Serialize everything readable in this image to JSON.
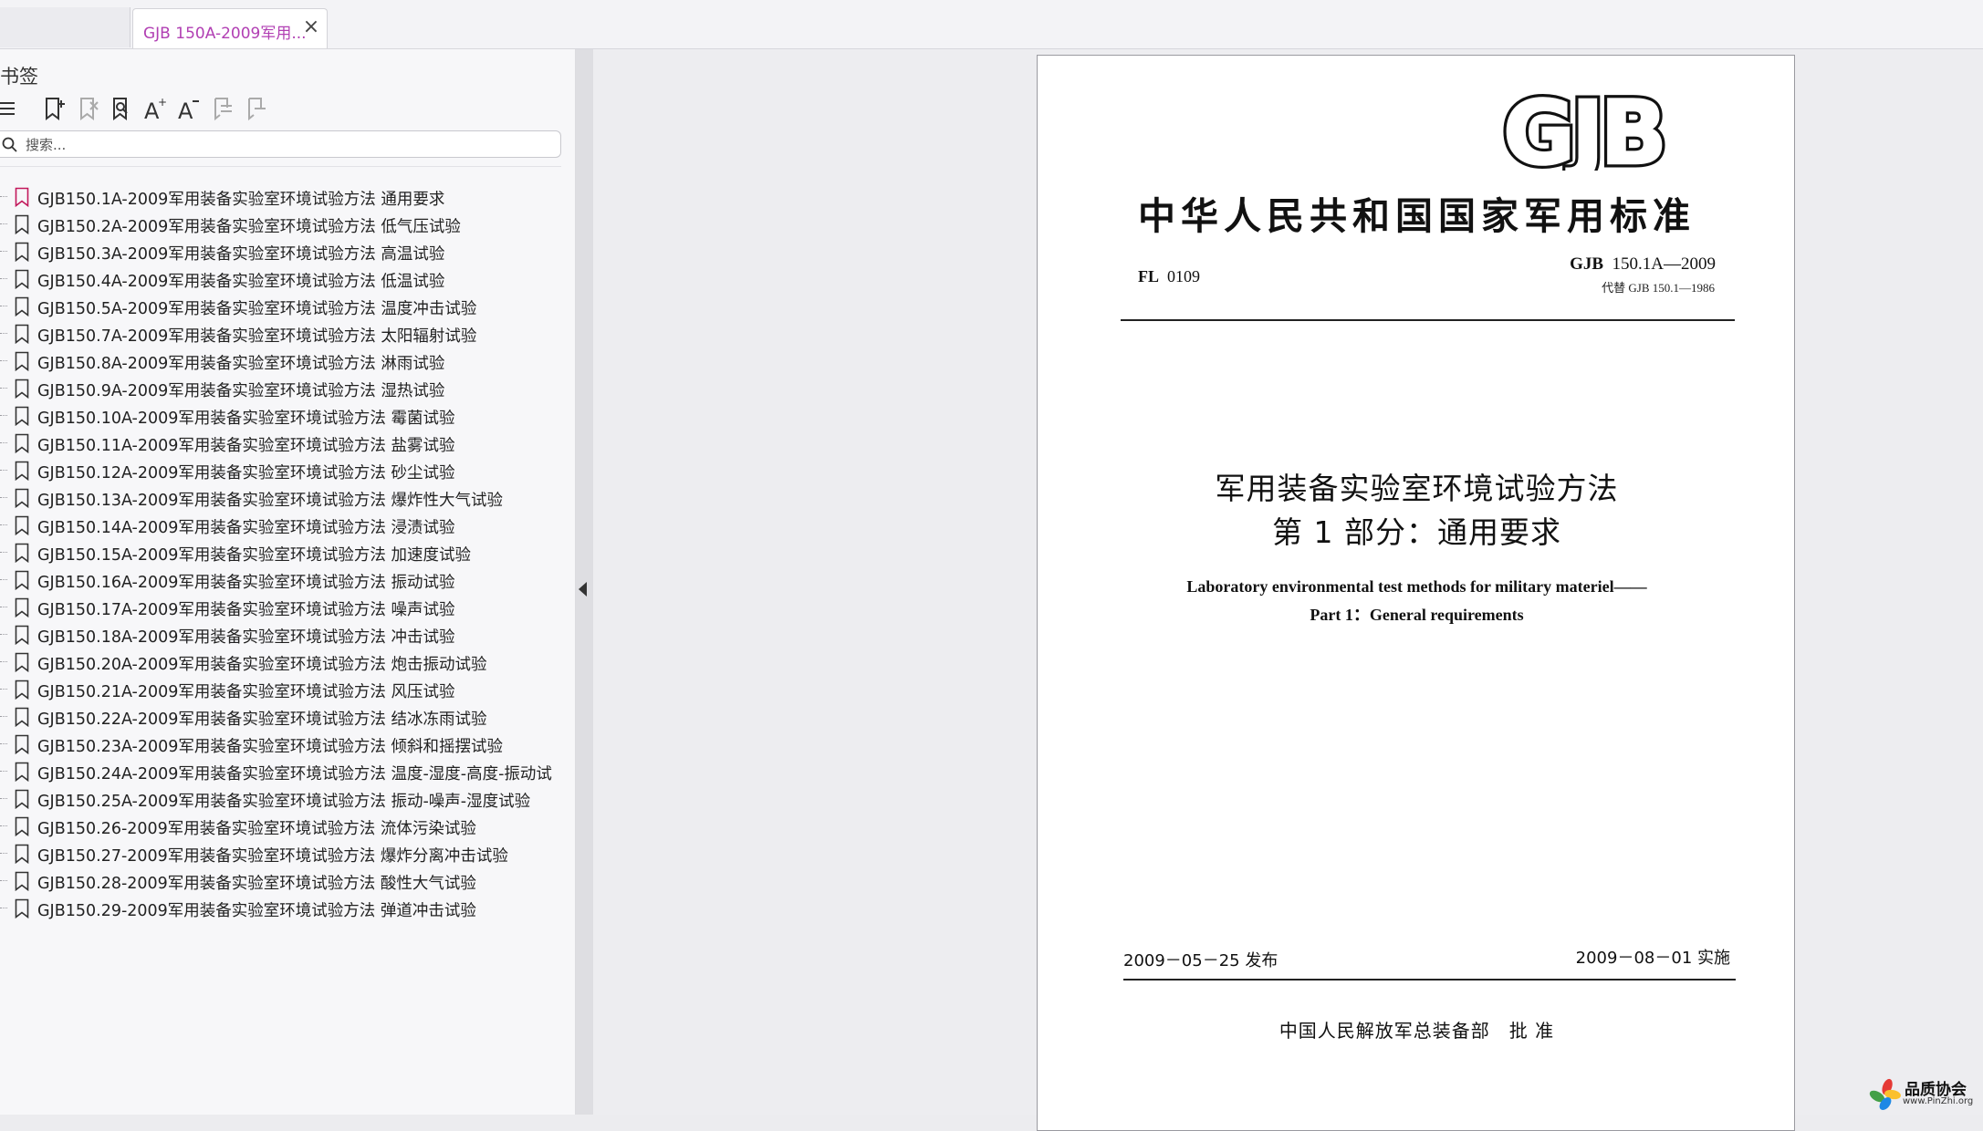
{
  "tabs": [
    {
      "label": "",
      "active": false
    },
    {
      "label": "GJB 150A-2009军用...",
      "active": true,
      "close_icon": "close-icon"
    }
  ],
  "sidebar": {
    "title": "书签",
    "toolbar": [
      "list-menu-icon",
      "add-bookmark-icon",
      "delete-bookmark-icon",
      "bookmark-search-icon",
      "font-increase-icon",
      "font-decrease-icon",
      "expand-bookmark-icon",
      "collapse-bookmark-icon"
    ],
    "search_placeholder": "搜索...",
    "bookmarks": [
      {
        "label": "GJB150.1A-2009军用装备实验室环境试验方法 通用要求",
        "active": true
      },
      {
        "label": "GJB150.2A-2009军用装备实验室环境试验方法 低气压试验"
      },
      {
        "label": "GJB150.3A-2009军用装备实验室环境试验方法 高温试验"
      },
      {
        "label": "GJB150.4A-2009军用装备实验室环境试验方法 低温试验"
      },
      {
        "label": "GJB150.5A-2009军用装备实验室环境试验方法 温度冲击试验"
      },
      {
        "label": "GJB150.7A-2009军用装备实验室环境试验方法 太阳辐射试验"
      },
      {
        "label": "GJB150.8A-2009军用装备实验室环境试验方法 淋雨试验"
      },
      {
        "label": "GJB150.9A-2009军用装备实验室环境试验方法 湿热试验"
      },
      {
        "label": "GJB150.10A-2009军用装备实验室环境试验方法 霉菌试验"
      },
      {
        "label": "GJB150.11A-2009军用装备实验室环境试验方法 盐雾试验"
      },
      {
        "label": "GJB150.12A-2009军用装备实验室环境试验方法 砂尘试验"
      },
      {
        "label": "GJB150.13A-2009军用装备实验室环境试验方法 爆炸性大气试验"
      },
      {
        "label": "GJB150.14A-2009军用装备实验室环境试验方法 浸渍试验"
      },
      {
        "label": "GJB150.15A-2009军用装备实验室环境试验方法 加速度试验"
      },
      {
        "label": "GJB150.16A-2009军用装备实验室环境试验方法 振动试验"
      },
      {
        "label": "GJB150.17A-2009军用装备实验室环境试验方法 噪声试验"
      },
      {
        "label": "GJB150.18A-2009军用装备实验室环境试验方法 冲击试验"
      },
      {
        "label": "GJB150.20A-2009军用装备实验室环境试验方法 炮击振动试验"
      },
      {
        "label": "GJB150.21A-2009军用装备实验室环境试验方法 风压试验"
      },
      {
        "label": "GJB150.22A-2009军用装备实验室环境试验方法 结冰冻雨试验"
      },
      {
        "label": "GJB150.23A-2009军用装备实验室环境试验方法 倾斜和摇摆试验"
      },
      {
        "label": "GJB150.24A-2009军用装备实验室环境试验方法 温度-湿度-高度-振动试"
      },
      {
        "label": "GJB150.25A-2009军用装备实验室环境试验方法 振动-噪声-湿度试验"
      },
      {
        "label": "GJB150.26-2009军用装备实验室环境试验方法 流体污染试验"
      },
      {
        "label": "GJB150.27-2009军用装备实验室环境试验方法 爆炸分离冲击试验"
      },
      {
        "label": "GJB150.28-2009军用装备实验室环境试验方法 酸性大气试验"
      },
      {
        "label": "GJB150.29-2009军用装备实验室环境试验方法 弹道冲击试验"
      }
    ]
  },
  "document": {
    "logo": "GJB",
    "national_title": "中华人民共和国国家军用标准",
    "fl_label": "FL",
    "fl_code": "0109",
    "std_prefix": "GJB",
    "std_number": "150.1A—2009",
    "replaces": "代替 GJB 150.1—1986",
    "title_cn_1": "军用装备实验室环境试验方法",
    "title_cn_2": "第 1 部分：通用要求",
    "title_en_1": "Laboratory environmental test methods for military materiel——",
    "title_en_2": "Part 1：General requirements",
    "issue_date": "2009－05－25 发布",
    "implement_date": "2009－08－01 实施",
    "approver": "中国人民解放军总装备部　批 准"
  },
  "watermark": {
    "line1": "品质协会",
    "line2": "www.PinZhi.org"
  },
  "colors": {
    "accent": "#b13fb3",
    "active_bookmark": "#c2185b"
  }
}
